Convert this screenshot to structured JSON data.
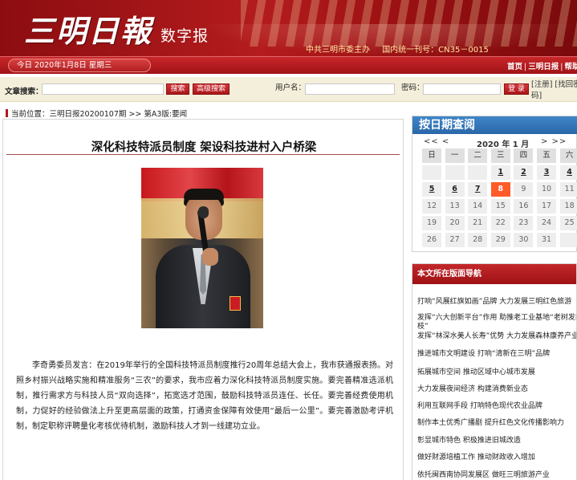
{
  "header": {
    "logo": "三明日報",
    "logo_sub": "数字报",
    "sponsor": "中共三明市委主办",
    "issn": "国内统一刊号：CN35－0015"
  },
  "datebar": {
    "today": "今日  2020年1月8日 星期三",
    "links": [
      "首页",
      "三明日报",
      "帮助"
    ]
  },
  "searchbar": {
    "label": "文章搜索：",
    "search_btn": "搜索",
    "adv_btn": "高级搜索",
    "user_label": "用户名：",
    "pass_label": "密码：",
    "login_btn": "登 录",
    "register": "[注册] [找回密码]"
  },
  "breadcrumb": {
    "label": "当前位置：",
    "items": [
      "三明日报20200107期",
      ">>",
      "第A3版:要闻"
    ]
  },
  "article": {
    "title": "深化科技特派员制度 架设科技进村入户桥梁",
    "body": "李奇勇委员发言：在2019年举行的全国科技特派员制度推行20周年总结大会上，我市获通报表扬。对照乡村振兴战略实施和精准服务“三农”的要求，我市应着力深化科技特派员制度实施。要完善精准选派机制，推行需求方与科技人员“双向选择”，拓宽选才范围，鼓励科技特派员连任、长任。要完善经费使用机制，力促好的经验做法上升至更高层面的政策，打通资金保障有效使用“最后一公里”。要完善激励考评机制，制定职称评聘量化考核优待机制，激励科技人才到一线建功立业。"
  },
  "calendar": {
    "title": "按日期查阅",
    "prev": "<< <",
    "month": "2020 年 1 月",
    "next": "> >>",
    "weekdays": [
      "日",
      "一",
      "二",
      "三",
      "四",
      "五",
      "六"
    ],
    "weeks": [
      [
        "",
        "",
        "",
        "1",
        "2",
        "3",
        "4"
      ],
      [
        "5",
        "6",
        "7",
        "8",
        "9",
        "10",
        "11"
      ],
      [
        "12",
        "13",
        "14",
        "15",
        "16",
        "17",
        "18"
      ],
      [
        "19",
        "20",
        "21",
        "22",
        "23",
        "24",
        "25"
      ],
      [
        "26",
        "27",
        "28",
        "29",
        "30",
        "31",
        ""
      ]
    ],
    "linked_days": [
      "1",
      "2",
      "3",
      "4",
      "5",
      "6",
      "7"
    ],
    "today": "8"
  },
  "page_nav": {
    "title": "本文所在版面导航",
    "items": [
      "打响“风展红旗如画”品牌 大力发展三明红色旅游",
      "发挥“六大创新平台”作用 助推老工业基地“老树发新枝”",
      "发挥“林深水美人长寿”优势 大力发展森林康养产业",
      "推进城市文明建设 打响“清新在三明”品牌",
      "拓展城市空间 推动区域中心城市发展",
      "大力发展夜间经济 构建消费新业态",
      "利用互联网手段 打响特色现代农业品牌",
      "制作本土优秀广播剧 提升红色文化传播影响力",
      "彰显城市特色 积极推进旧城改造",
      "做好财源培植工作 推动财政收入增加",
      "依托闽西南协同发展区 做旺三明旅游产业"
    ]
  },
  "colors": {
    "brand_red": "#b41c1e",
    "calendar_blue": "#2a67a8",
    "today_orange": "#ff5a2a"
  }
}
